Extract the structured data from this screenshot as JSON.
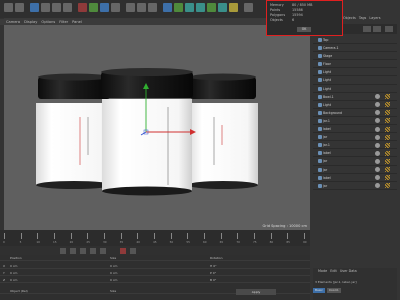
{
  "info_box": {
    "rows": [
      {
        "key": "Memory",
        "value": "80 / 850 MB"
      },
      {
        "key": "Points",
        "value": "15586"
      },
      {
        "key": "Polygons",
        "value": "15594"
      },
      {
        "key": "Objects",
        "value": "6"
      }
    ],
    "ok_label": "OK"
  },
  "viewport": {
    "menu": [
      "Camera",
      "Display",
      "Options",
      "Filter",
      "Panel"
    ],
    "grid_spacing": "Grid Spacing : 10000 cm"
  },
  "object_manager": {
    "tabs": [
      "Objects",
      "Tags",
      "Layers"
    ],
    "items": [
      {
        "label": "Top"
      },
      {
        "label": "Camera.1"
      },
      {
        "label": "Stage"
      },
      {
        "label": "Floor"
      },
      {
        "label": "Light"
      },
      {
        "label": "Light"
      },
      {
        "label": "Light"
      },
      {
        "label": "Bowl.1"
      },
      {
        "label": "Light"
      },
      {
        "label": "Background"
      },
      {
        "label": "jar.1"
      },
      {
        "label": "label"
      },
      {
        "label": "jar"
      },
      {
        "label": "jar.1"
      },
      {
        "label": "label"
      },
      {
        "label": "jar"
      },
      {
        "label": "jar"
      },
      {
        "label": "label"
      },
      {
        "label": "jar"
      }
    ]
  },
  "attributes": {
    "tabs": [
      "Mode",
      "Edit",
      "User Data"
    ],
    "status": "3 Elements [jar.1, label, jar]",
    "buttons": [
      "Basic",
      "Coord."
    ]
  },
  "timeline": {
    "ticks": [
      "0",
      "5",
      "10",
      "15",
      "20",
      "25",
      "30",
      "35",
      "40",
      "45",
      "50",
      "55",
      "60",
      "65",
      "70",
      "75",
      "80",
      "85",
      "90"
    ]
  },
  "coordinates": {
    "headers": [
      "Position",
      "Size",
      "Rotation"
    ],
    "rows": [
      {
        "axis": "X",
        "pos": "0 cm",
        "size": "0 cm",
        "rot": "H 0°"
      },
      {
        "axis": "Y",
        "pos": "0 cm",
        "size": "0 cm",
        "rot": "P 0°"
      },
      {
        "axis": "Z",
        "pos": "0 cm",
        "size": "0 cm",
        "rot": "B 0°"
      }
    ],
    "mode": "Object (Rel)",
    "size_mode": "Size",
    "apply": "Apply"
  },
  "colors": {
    "highlight": "#e02020",
    "viewport_bg": "#5f5f5f",
    "jar_lid": "#141414",
    "jar_body": "#f4f4f4",
    "axis_x": "#d03030",
    "axis_y": "#30b030",
    "axis_z": "#3050d0"
  }
}
